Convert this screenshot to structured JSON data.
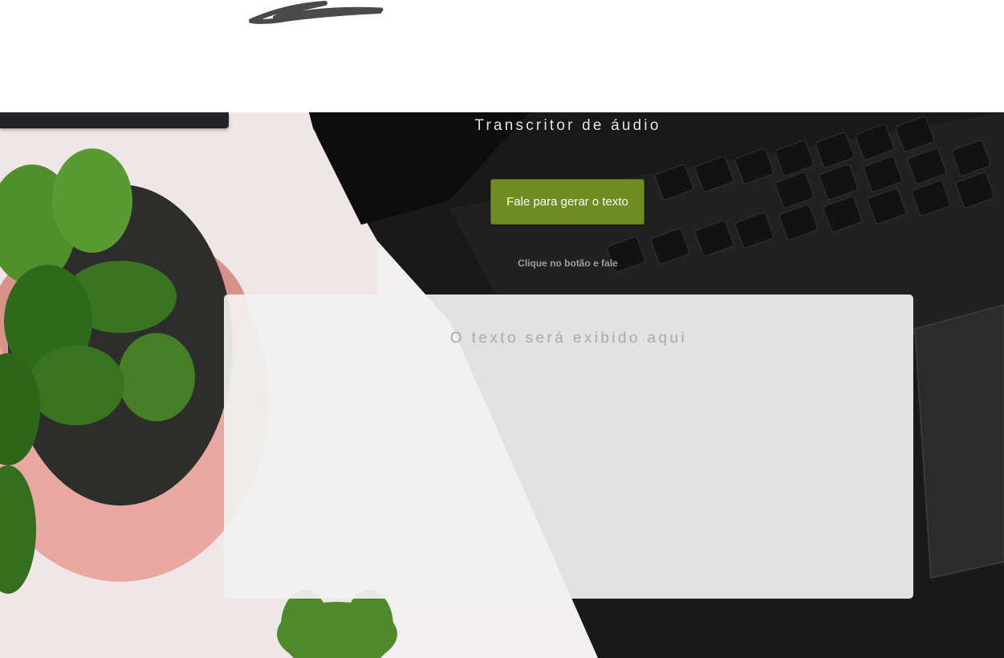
{
  "app": {
    "title": "Transcritor de áudio"
  },
  "controls": {
    "speak_button_label": "Fale para gerar o texto",
    "hint": "Clique no botão e fale"
  },
  "output": {
    "placeholder": "O texto será exibido aqui"
  },
  "colors": {
    "accent": "#708b21",
    "background": "#ffffff",
    "output_box": "#f1f1f1"
  },
  "icons": [
    "logo-scribble"
  ]
}
